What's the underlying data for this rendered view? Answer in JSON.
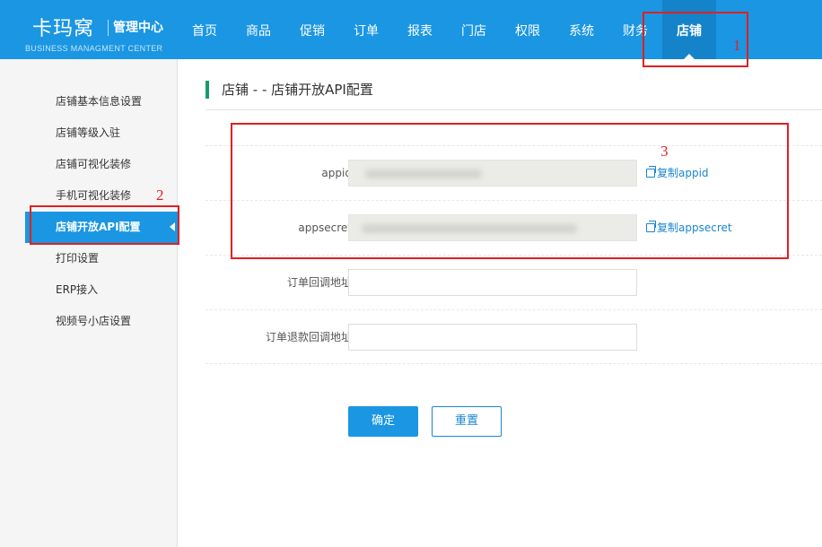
{
  "header": {
    "logo_mark": "卡玛窝",
    "title": "管理中心",
    "subtitle": "BUSINESS MANAGMENT CENTER",
    "nav": [
      {
        "label": "首页"
      },
      {
        "label": "商品"
      },
      {
        "label": "促销"
      },
      {
        "label": "订单"
      },
      {
        "label": "报表"
      },
      {
        "label": "门店"
      },
      {
        "label": "权限"
      },
      {
        "label": "系统"
      },
      {
        "label": "财务"
      },
      {
        "label": "店铺",
        "active": true
      }
    ]
  },
  "sidebar": {
    "items": [
      {
        "label": "店铺基本信息设置"
      },
      {
        "label": "店铺等级入驻"
      },
      {
        "label": "店铺可视化装修"
      },
      {
        "label": "手机可视化装修"
      },
      {
        "label": "店铺开放API配置",
        "active": true
      },
      {
        "label": "打印设置"
      },
      {
        "label": "ERP接入"
      },
      {
        "label": "视频号小店设置"
      }
    ]
  },
  "main": {
    "page_title": "店铺 - - 店铺开放API配置",
    "fields": [
      {
        "label": "appid:",
        "value": "",
        "copy_label": "复制appid"
      },
      {
        "label": "appsecret:",
        "value": "",
        "copy_label": "复制appsecret"
      },
      {
        "label": "订单回调地址:",
        "value": ""
      },
      {
        "label": "订单退款回调地址:",
        "value": ""
      }
    ],
    "confirm_label": "确定",
    "reset_label": "重置"
  },
  "annotations": [
    {
      "number": "1"
    },
    {
      "number": "2"
    },
    {
      "number": "3"
    }
  ],
  "colors": {
    "brand": "#1a96e3",
    "brand_active": "#1483c9",
    "link": "#1a86d0",
    "title_accent": "#1a9a6a",
    "annotation": "#e02020"
  }
}
